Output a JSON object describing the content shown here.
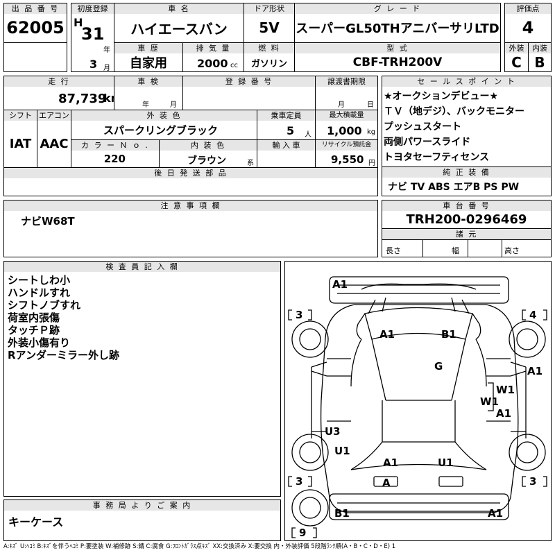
{
  "header": {
    "lot_label": "出 品 番 号",
    "lot": "62005",
    "first_reg_label": "初度登録",
    "era": "H",
    "year": "31",
    "year_unit": "年",
    "month": "3",
    "month_unit": "月",
    "name_label": "車 名",
    "name": "ハイエースバン",
    "door_label": "ドア形状",
    "door": "5V",
    "grade_label": "グ レ ー ド",
    "grade": "スーパーGL50THアニバーサリLTD",
    "score_label": "評価点",
    "score": "4",
    "history_label": "車 歴",
    "history": "自家用",
    "displacement_label": "排 気 量",
    "displacement": "2000",
    "displacement_unit": "cc",
    "fuel_label": "燃 料",
    "fuel": "ガソリン",
    "model_label": "型 式",
    "model": "CBF-TRH200V",
    "ext_score_label": "外装",
    "ext_score": "C",
    "int_score_label": "内装",
    "int_score": "B"
  },
  "details": {
    "mileage_label": "走 行",
    "mileage": "87,739",
    "mileage_unit": "km",
    "inspection_label": "車 検",
    "inspection_year_unit": "年",
    "inspection_month_unit": "月",
    "reg_no_label": "登 録 番 号",
    "transfer_label": "譲渡書期限",
    "transfer_month_unit": "月",
    "transfer_day_unit": "日",
    "shift_label": "シフト",
    "shift": "IAT",
    "aircon_label": "エアコン",
    "aircon": "AAC",
    "ext_color_label": "外 装 色",
    "ext_color": "スパークリングブラック",
    "capacity_label": "乗車定員",
    "capacity": "5",
    "capacity_unit": "人",
    "max_load_label": "最大積載量",
    "max_load": "1,000",
    "max_load_unit": "kg",
    "color_no_label": "カ ラ ー Ｎ ｏ .",
    "color_no": "220",
    "int_color_label": "内 装 色",
    "int_color": "ブラウン",
    "int_color_unit": "系",
    "import_label": "輸 入 車",
    "recycle_label": "リサイクル預託金",
    "recycle": "9,550",
    "recycle_unit": "円",
    "later_parts_label": "後 日 発 送 部 品"
  },
  "sales": {
    "label": "セ ー ル ス ポ イ ン ト",
    "points": "★オークションデビュー★\nＴＶ（地デジ）、バックモニター\nプッシュスタート\n両側パワースライド\nトヨタセーフティセンス",
    "equip_label": "純 正 装 備",
    "equip": "ナビ TV ABS エアB PS PW"
  },
  "notes": {
    "label": "注 意 事 項 欄",
    "text": "ナビW68T"
  },
  "chassis": {
    "label": "車 台 番 号",
    "number": "TRH200-0296469",
    "spec_label": "諸 元",
    "length_label": "長さ",
    "width_label": "幅",
    "height_label": "高さ"
  },
  "inspector": {
    "label": "検 査 員 記 入 欄",
    "text": "シートしわ小\nハンドルすれ\nシフトノブすれ\n荷室内張傷\nタッチＰ跡\n外装小傷有り\nRアンダーミラー外し跡"
  },
  "office": {
    "label": "事 務 局 よ り ご 案 内",
    "text": "キーケース"
  },
  "diagram": {
    "tire_fl": "3",
    "tire_fr": "4",
    "tire_rl": "3",
    "tire_rr": "3",
    "tire_spare": "9",
    "marks": [
      "A1",
      "A1",
      "B1",
      "G",
      "A1",
      "W1",
      "W1",
      "A1",
      "U3",
      "U1",
      "A1",
      "U1",
      "A",
      "B1",
      "A1"
    ]
  },
  "legend": "A:ｷｽﾞ U:ﾍｺﾐ B:ｷｽﾞを伴うﾍｺﾐ P:要塗装 W:補修跡 S:錆 C:腐食 G:ﾌﾛﾝﾄｶﾞﾗｽ点ｷｽﾞ XX:交換済み X:要交換 内・外装評価 5段階ﾗﾝｸ順(A・B・C・D・E) 1"
}
